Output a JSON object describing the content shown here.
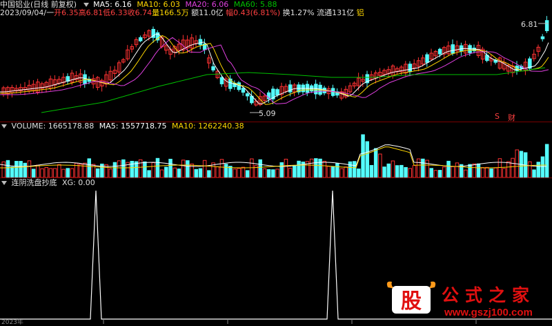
{
  "header": {
    "title": "中国铝业(日线 前复权)",
    "ma5": "MA5: 6.16",
    "ma10": "MA10: 6.03",
    "ma20": "MA20: 6.06",
    "ma60": "MA60: 5.88",
    "ma5_color": "#ffffff",
    "ma10_color": "#ffd700",
    "ma20_color": "#e040e0",
    "ma60_color": "#00c000"
  },
  "info": {
    "date": "2023/09/04/一",
    "open": "开6.35",
    "high": "高6.81",
    "low": "低6.33",
    "close": "收6.74",
    "volume": "量166.5万",
    "amount": "额11.0亿",
    "change": "幅0.43(6.81%)",
    "turnover": "换1.27%",
    "float": "流通131亿",
    "sector": "铝"
  },
  "main_chart": {
    "high_label": "6.81",
    "low_label": "5.09",
    "marker_s": "S",
    "marker_cai": "财",
    "up_color": "#ff3232",
    "down_color": "#54fcfc"
  },
  "volume_header": {
    "volume": "VOLUME: 1665178.88",
    "ma5": "MA5: 1557718.75",
    "ma10": "MA10: 1262240.38"
  },
  "indicator_header": {
    "name": "连阴洗盘抄底",
    "xg": "XG: 0.00"
  },
  "axis": {
    "year_label": "2023年"
  },
  "watermark": {
    "badge": "股",
    "name": "公式之家",
    "url": "www.gszj100.com"
  }
}
